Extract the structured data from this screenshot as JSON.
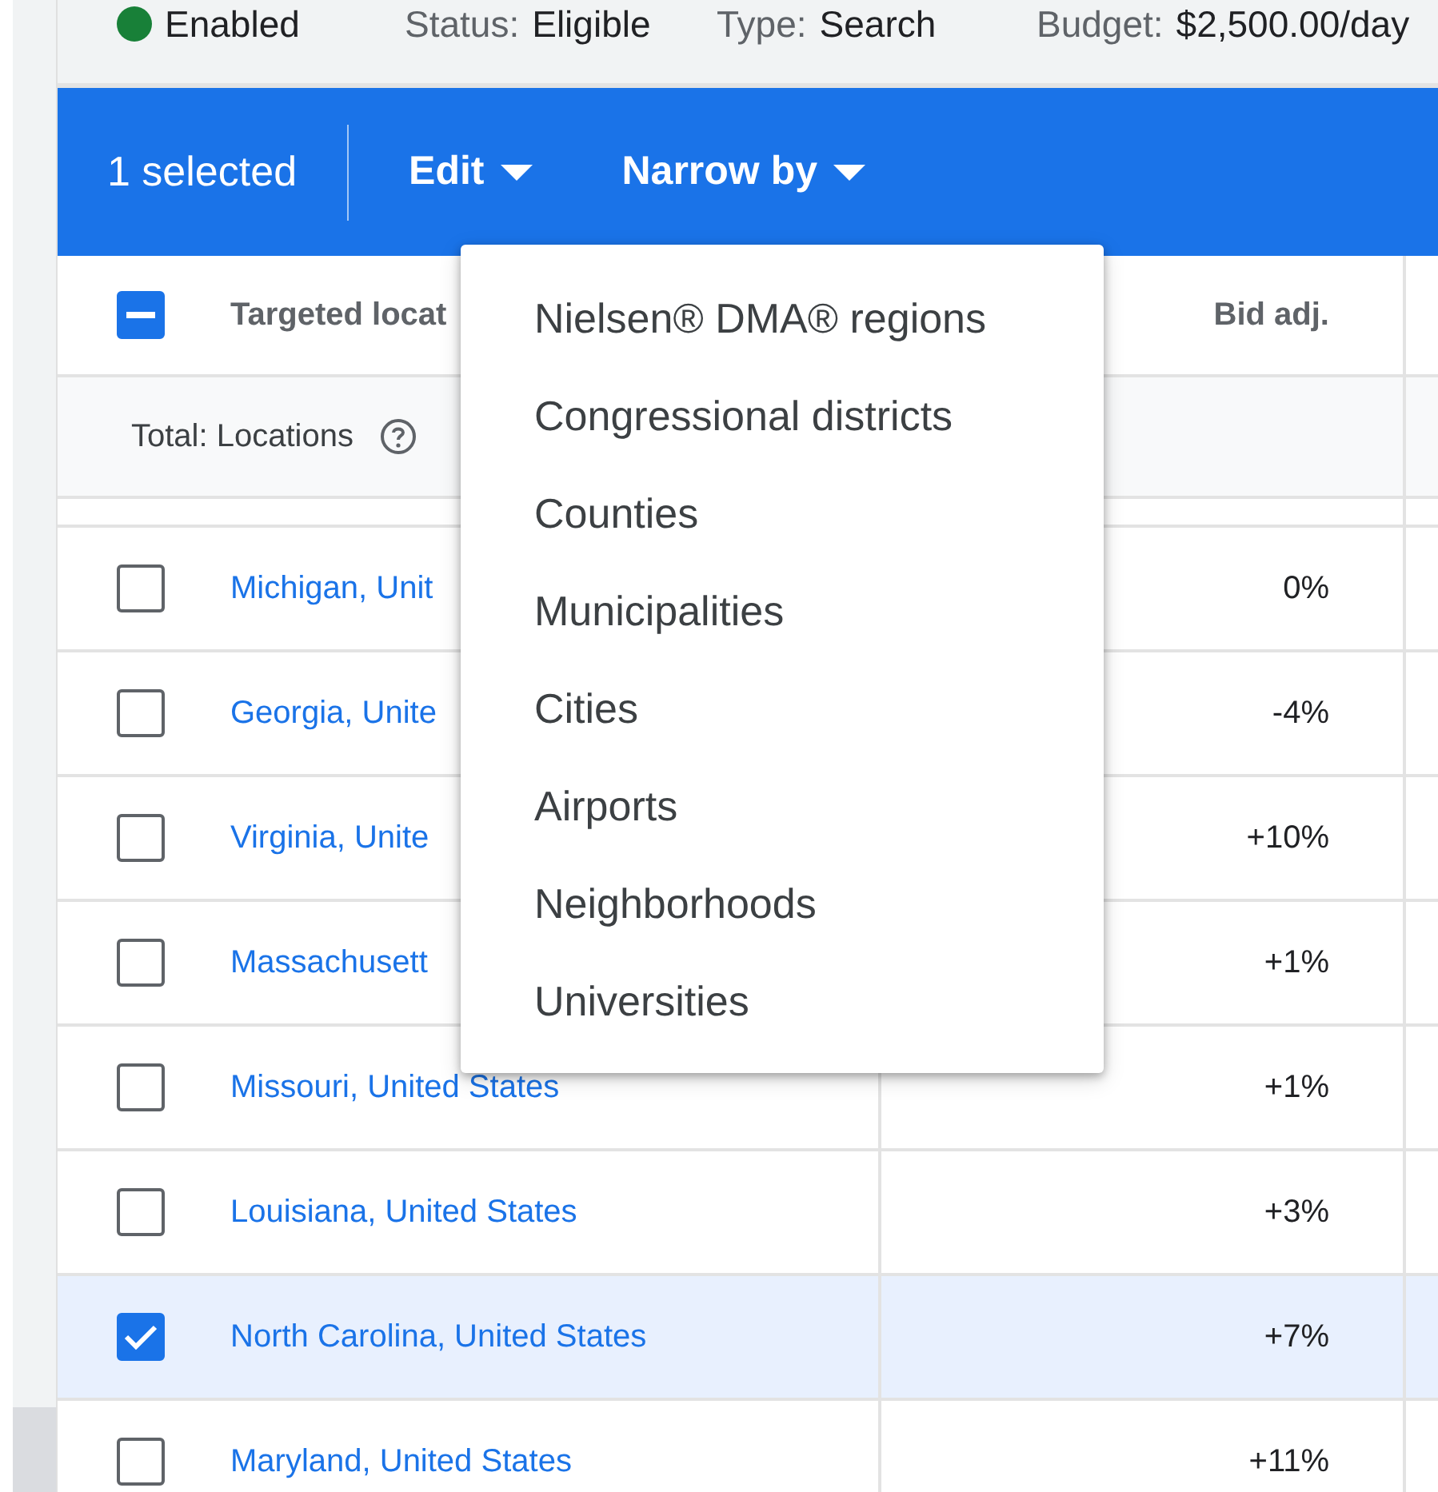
{
  "summary": {
    "state": "Enabled",
    "fields": [
      {
        "label": "Status:",
        "value": "Eligible"
      },
      {
        "label": "Type:",
        "value": "Search"
      },
      {
        "label": "Budget:",
        "value": "$2,500.00/day"
      }
    ]
  },
  "toolbar": {
    "selection_count": "1 selected",
    "buttons": [
      {
        "label": "Edit"
      },
      {
        "label": "Narrow by"
      }
    ]
  },
  "table": {
    "header": {
      "select_all": {
        "indeterminate": true
      },
      "columns": [
        "Targeted locat",
        "Bid adj."
      ]
    },
    "total_row": {
      "label": "Total: Locations"
    },
    "rows": [
      {
        "location": "Michigan, Unit",
        "bid_adj": "0%",
        "checked": false
      },
      {
        "location": "Georgia, Unite",
        "bid_adj": "-4%",
        "checked": false
      },
      {
        "location": "Virginia, Unite",
        "bid_adj": "+10%",
        "checked": false
      },
      {
        "location": "Massachusett",
        "bid_adj": "+1%",
        "checked": false
      },
      {
        "location": "Missouri, United States",
        "bid_adj": "+1%",
        "checked": false
      },
      {
        "location": "Louisiana, United States",
        "bid_adj": "+3%",
        "checked": false
      },
      {
        "location": "North Carolina, United States",
        "bid_adj": "+7%",
        "checked": true
      },
      {
        "location": "Maryland, United States",
        "bid_adj": "+11%",
        "checked": false
      }
    ]
  },
  "narrow_by_menu": {
    "items": [
      "Nielsen® DMA® regions",
      "Congressional districts",
      "Counties",
      "Municipalities",
      "Cities",
      "Airports",
      "Neighborhoods",
      "Universities"
    ]
  }
}
